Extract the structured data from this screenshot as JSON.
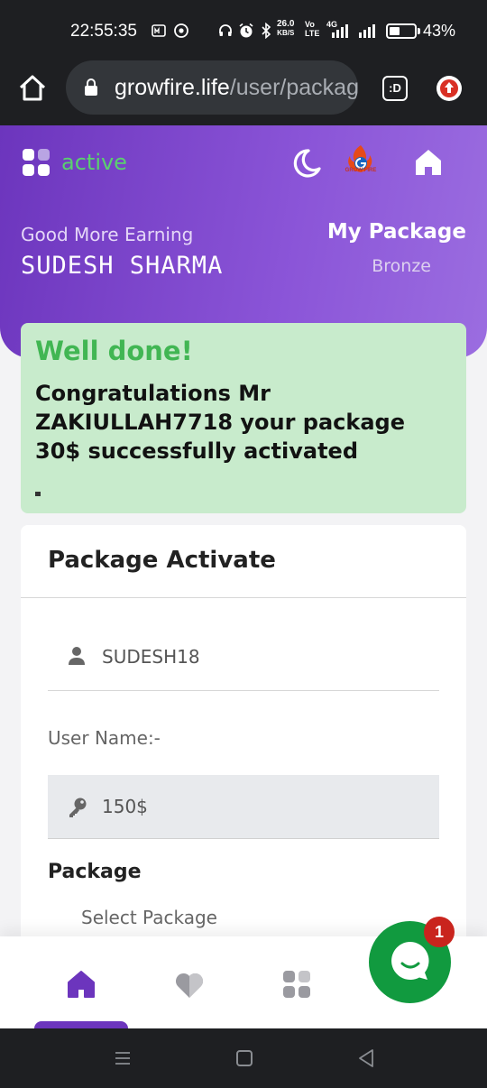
{
  "status_bar": {
    "time": "22:55:35",
    "net_speed": "26.0",
    "net_unit": "KB/S",
    "volte_top": "Vo",
    "volte_bottom": "LTE",
    "signal_label": "4G",
    "battery_pct": "43%",
    "battery_level": 0.43
  },
  "browser": {
    "url_domain": "growfire.life",
    "url_path": "/user/package",
    "tabs_label": ":D",
    "icons": [
      "home-icon",
      "lock-icon",
      "tabs-icon",
      "update-icon"
    ]
  },
  "header": {
    "active_label": "active",
    "logo_text": "GROW FIRE",
    "greeting": "Good More Earning",
    "user_name": "SUDESH  SHARMA",
    "my_package_label": "My Package",
    "package_name": "Bronze",
    "colors": {
      "primary": "#6c35bd",
      "active_green": "#5ad06f"
    }
  },
  "alert": {
    "title": "Well done!",
    "message": "Congratulations Mr ZAKIULLAH7718 your package 30$ successfully activated",
    "bg_color": "#c8ebcc",
    "title_color": "#41b653"
  },
  "card": {
    "title": "Package Activate",
    "username_value": "SUDESH18",
    "user_name_label": "User Name:-",
    "amount_value": "150$",
    "package_label": "Package",
    "select_placeholder": "Select Package"
  },
  "bottom_nav": {
    "items": [
      "home-icon",
      "heart-icon",
      "apps-icon"
    ],
    "active_index": 0
  },
  "chat": {
    "badge_count": "1",
    "bg_color": "#119a3f"
  }
}
